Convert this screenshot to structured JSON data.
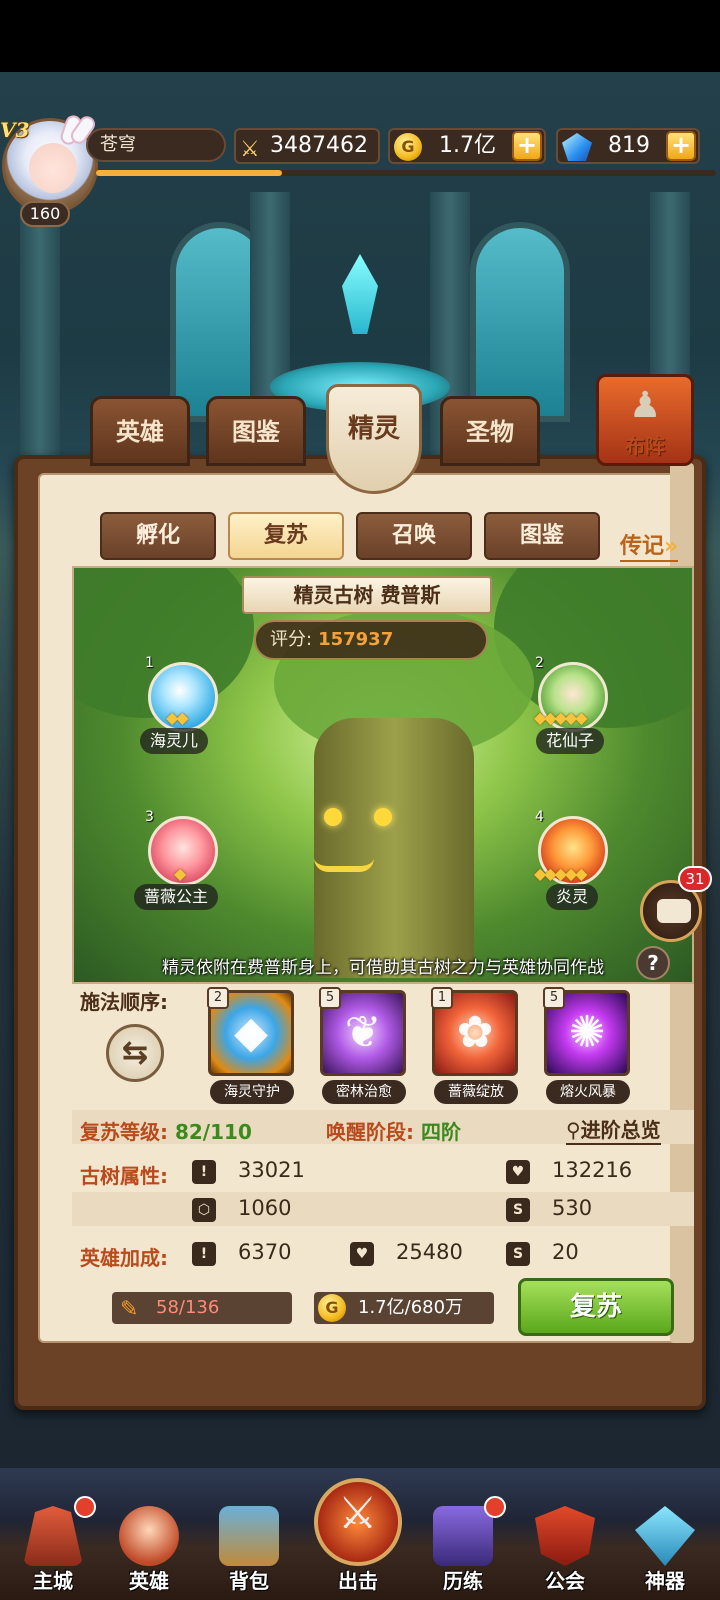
{
  "header": {
    "vip": "V3",
    "level": "160",
    "player_name": "苍穹",
    "power": "3487462",
    "gold": "1.7亿",
    "gems": "819",
    "gold_symbol": "G",
    "plus": "+",
    "exp_progress": 0.3
  },
  "main_tabs": {
    "hero": "英雄",
    "atlas": "图鉴",
    "spirit": "精灵",
    "relic": "圣物",
    "formation": "布阵"
  },
  "sub_tabs": {
    "hatch": "孵化",
    "revive": "复苏",
    "summon": "召唤",
    "atlas": "图鉴",
    "legend": "传记"
  },
  "tree": {
    "title": "精灵古树 费普斯",
    "score_label": "评分:",
    "score": "157937",
    "description": "精灵依附在费普斯身上，可借助其古树之力与英雄协同作战"
  },
  "sprites": [
    {
      "slot": "1",
      "name": "海灵儿",
      "stars": 2
    },
    {
      "slot": "2",
      "name": "花仙子",
      "stars": 5
    },
    {
      "slot": "3",
      "name": "蔷薇公主",
      "stars": 1
    },
    {
      "slot": "4",
      "name": "炎灵",
      "stars": 5
    }
  ],
  "chat_badge": "31",
  "help": "?",
  "cast": {
    "label": "施法顺序:",
    "skills": [
      {
        "level": "2",
        "name": "海灵守护"
      },
      {
        "level": "5",
        "name": "密林治愈"
      },
      {
        "level": "1",
        "name": "蔷薇绽放"
      },
      {
        "level": "5",
        "name": "熔火风暴"
      }
    ]
  },
  "progress": {
    "revive_level_label": "复苏等级:",
    "revive_level": "82/110",
    "awaken_label": "唤醒阶段:",
    "awaken_stage": "四阶",
    "advance_link": "进阶总览"
  },
  "tree_stats": {
    "label": "古树属性:",
    "attack": "33021",
    "hp": "132216",
    "defense": "1060",
    "speed": "530"
  },
  "hero_bonus": {
    "label": "英雄加成:",
    "attack": "6370",
    "hp": "25480",
    "speed": "20"
  },
  "cost": {
    "material": "58/136",
    "gold": "1.7亿/680万"
  },
  "revive_button": "复苏",
  "bottom_nav": {
    "castle": "主城",
    "hero": "英雄",
    "bag": "背包",
    "battle": "出击",
    "train": "历练",
    "guild": "公会",
    "artifact": "神器"
  },
  "colors": {
    "accent_gold": "#f4b13a",
    "label_red": "#b94a1c",
    "value_green": "#3b8a1e",
    "button_green": "#5aa81c"
  }
}
